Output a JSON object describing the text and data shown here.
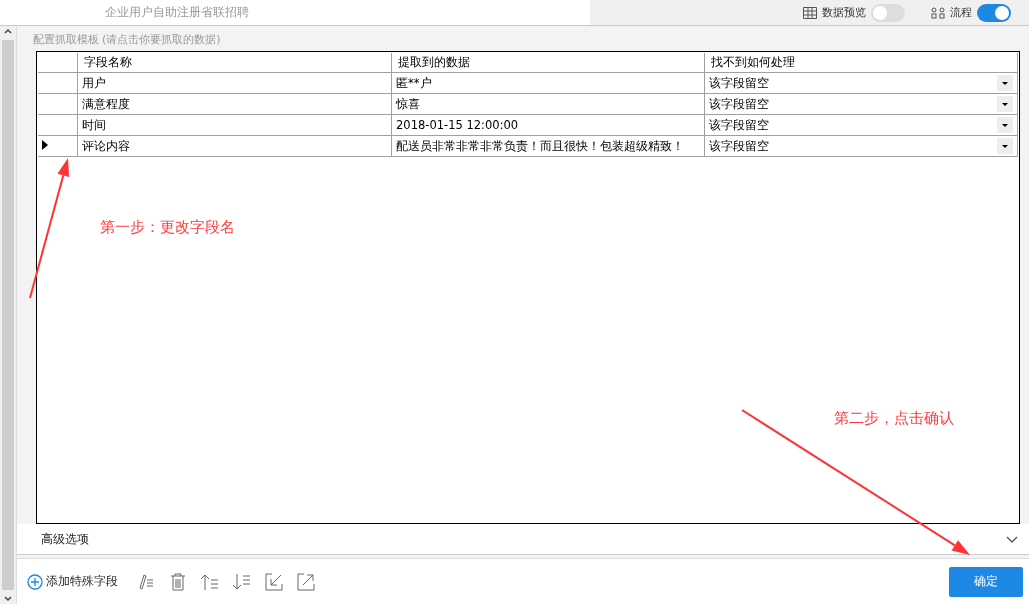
{
  "top_bar": {
    "title": "企业用户自助注册省联招聘",
    "toggles": [
      {
        "label": "数据预览",
        "on": false
      },
      {
        "label": "流程",
        "on": true
      }
    ]
  },
  "panel_title": "配置抓取模板 (请点击你要抓取的数据)",
  "table": {
    "columns": [
      "字段名称",
      "提取到的数据",
      "找不到如何处理"
    ],
    "rows": [
      {
        "field": "用户",
        "data": "匿**户",
        "fallback": "该字段留空",
        "selected": false
      },
      {
        "field": "满意程度",
        "data": "惊喜",
        "fallback": "该字段留空",
        "selected": false
      },
      {
        "field": "时间",
        "data": "2018-01-15 12:00:00",
        "fallback": "该字段留空",
        "selected": false
      },
      {
        "field": "评论内容",
        "data": "配送员非常非常非常负责！而且很快！包装超级精致！",
        "fallback": "该字段留空",
        "selected": true
      }
    ]
  },
  "annotations": [
    "第一步：更改字段名",
    "第二步，点击确认"
  ],
  "advanced": {
    "label": "高级选项",
    "expanded": false
  },
  "toolbar": {
    "add_label": "添加特殊字段",
    "confirm": "确定"
  }
}
